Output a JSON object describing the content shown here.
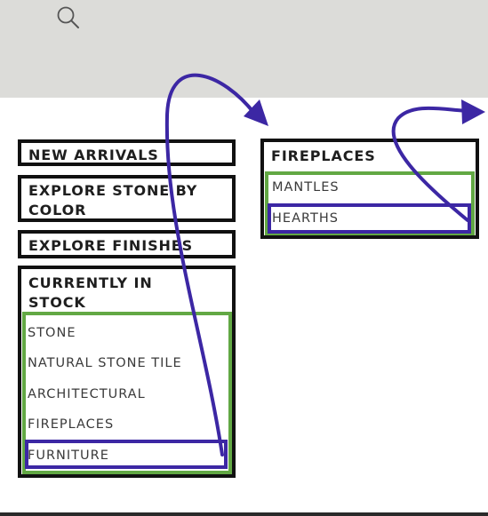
{
  "header": {
    "search_icon": "search-icon"
  },
  "menu": {
    "new_arrivals": "NEW ARRIVALS",
    "explore_color_line1": "EXPLORE STONE BY",
    "explore_color_line2": "COLOR",
    "explore_finishes": "EXPLORE FINISHES",
    "in_stock_line1": "CURRENTLY IN",
    "in_stock_line2": "STOCK",
    "in_stock_items": [
      "STONE",
      "NATURAL STONE TILE",
      "ARCHITECTURAL",
      "FIREPLACES",
      "FURNITURE"
    ]
  },
  "submenu": {
    "title": "FIREPLACES",
    "items": [
      "MANTLES",
      "HEARTHS"
    ]
  },
  "annotation_colors": {
    "menu_border": "#111111",
    "group_highlight": "#62a844",
    "selected_highlight": "#3c27a4",
    "arrow": "#3c27a4"
  }
}
